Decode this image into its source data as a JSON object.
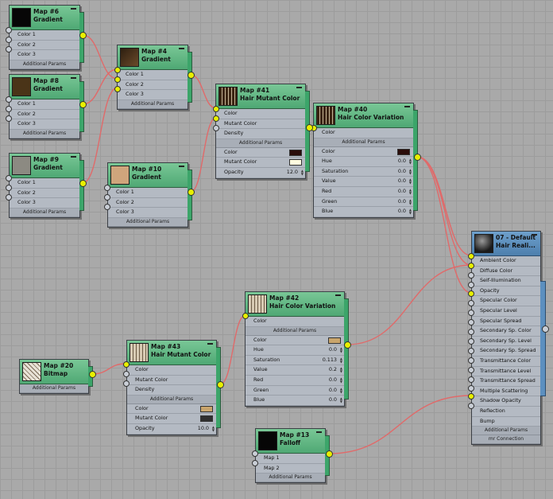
{
  "colors": {
    "wire": "#e06a6a",
    "connected_socket": "#e8f000",
    "node_header": "#5fb581",
    "node_body": "#b4bac3",
    "material_tab": "#5c8fbf"
  },
  "nodes": {
    "map6": {
      "title1": "Map #6",
      "title2": "Gradient",
      "rows": [
        "Color 1",
        "Color 2",
        "Color 3"
      ],
      "footer": "Additional Params"
    },
    "map8": {
      "title1": "Map #8",
      "title2": "Gradient",
      "rows": [
        "Color 1",
        "Color 2",
        "Color 3"
      ],
      "footer": "Additional Params"
    },
    "map9": {
      "title1": "Map #9",
      "title2": "Gradient",
      "rows": [
        "Color 1",
        "Color 2",
        "Color 3"
      ],
      "footer": "Additional Params"
    },
    "map4": {
      "title1": "Map #4",
      "title2": "Gradient",
      "rows": [
        "Color 1",
        "Color 2",
        "Color 3"
      ],
      "footer": "Additional Params"
    },
    "map10": {
      "title1": "Map #10",
      "title2": "Gradient",
      "rows": [
        "Color 1",
        "Color 2",
        "Color 3"
      ],
      "footer": "Additional Params"
    },
    "map41": {
      "title1": "Map #41",
      "title2": "Hair Mutant Color",
      "rows": [
        "Color",
        "Mutant Color",
        "Density"
      ],
      "sep": "Additional Params",
      "color": "Color",
      "mutant": "Mutant Color",
      "opacity": "Opacity",
      "opacity_value": "12.0"
    },
    "map40": {
      "title1": "Map #40",
      "title2": "Hair Color Variation",
      "rows": [
        "Color"
      ],
      "sep": "Additional Params",
      "params": [
        {
          "label": "Color"
        },
        {
          "label": "Hue",
          "value": "0.0"
        },
        {
          "label": "Saturation",
          "value": "0.0"
        },
        {
          "label": "Value",
          "value": "0.0"
        },
        {
          "label": "Red",
          "value": "0.0"
        },
        {
          "label": "Green",
          "value": "0.0"
        },
        {
          "label": "Blue",
          "value": "0.0"
        }
      ]
    },
    "map42": {
      "title1": "Map #42",
      "title2": "Hair Color Variation",
      "rows": [
        "Color"
      ],
      "sep": "Additional Params",
      "params": [
        {
          "label": "Color"
        },
        {
          "label": "Hue",
          "value": "0.0"
        },
        {
          "label": "Saturation",
          "value": "0.113"
        },
        {
          "label": "Value",
          "value": "0.2"
        },
        {
          "label": "Red",
          "value": "0.0"
        },
        {
          "label": "Green",
          "value": "0.0"
        },
        {
          "label": "Blue",
          "value": "0.0"
        }
      ]
    },
    "map43": {
      "title1": "Map #43",
      "title2": "Hair Mutant Color",
      "rows": [
        "Color",
        "Mutant Color",
        "Density"
      ],
      "sep": "Additional Params",
      "color": "Color",
      "mutant": "Mutant Color",
      "opacity": "Opacity",
      "opacity_value": "10.0"
    },
    "map20": {
      "title1": "Map #20",
      "title2": "Bitmap",
      "footer": "Additional Params"
    },
    "map13": {
      "title1": "Map #13",
      "title2": "Falloff",
      "rows": [
        "Map 1",
        "Map 2"
      ],
      "footer": "Additional Params"
    },
    "mat07": {
      "title1": "07 - Default",
      "title2": "Hair Reali...",
      "rows": [
        "Ambient Color",
        "Diffuse Color",
        "Self-Illumination",
        "Opacity",
        "Specular Color",
        "Specular Level",
        "Specular Spread",
        "Secondary Sp. Color",
        "Secondary Sp. Level",
        "Secondary Sp. Spread",
        "Transmittance Color",
        "Transmittance Level",
        "Transmittance Spread",
        "Multiple Scattering",
        "Shadow Opacity",
        "Reflection",
        "Bump"
      ],
      "sep1": "Additional Params",
      "sep2": "mr Connection"
    }
  }
}
